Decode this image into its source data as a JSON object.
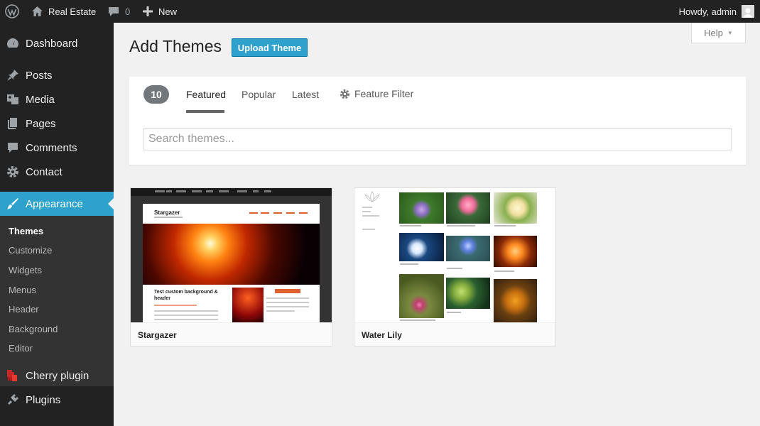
{
  "adminbar": {
    "site_name": "Real Estate",
    "comments_count": "0",
    "new_label": "New",
    "howdy": "Howdy, admin"
  },
  "sidebar": {
    "items": [
      {
        "label": "Dashboard",
        "icon": "dashboard-icon"
      },
      {
        "label": "Posts",
        "icon": "pin-icon"
      },
      {
        "label": "Media",
        "icon": "media-icon"
      },
      {
        "label": "Pages",
        "icon": "pages-icon"
      },
      {
        "label": "Comments",
        "icon": "comment-icon"
      },
      {
        "label": "Contact",
        "icon": "gear-icon"
      },
      {
        "label": "Appearance",
        "icon": "brush-icon",
        "active": true
      },
      {
        "label": "Cherry plugin",
        "icon": "cherry-icon"
      },
      {
        "label": "Plugins",
        "icon": "plug-icon"
      }
    ],
    "submenu": [
      "Themes",
      "Customize",
      "Widgets",
      "Menus",
      "Header",
      "Background",
      "Editor"
    ],
    "submenu_current": "Themes"
  },
  "main": {
    "title": "Add Themes",
    "upload_label": "Upload Theme",
    "help_label": "Help",
    "count": "10",
    "tabs": [
      "Featured",
      "Popular",
      "Latest"
    ],
    "current_tab": "Featured",
    "feature_filter_label": "Feature Filter",
    "search_placeholder": "Search themes...",
    "themes": [
      {
        "name": "Stargazer"
      },
      {
        "name": "Water Lily"
      }
    ],
    "stargazer_preview": {
      "site_title": "Stargazer",
      "post_title": "Test custom background & header"
    }
  },
  "colors": {
    "accent": "#2ea2cc",
    "adminbar_bg": "#222222",
    "sidebar_bg": "#222222",
    "submenu_bg": "#333333",
    "page_bg": "#f1f1f1"
  }
}
